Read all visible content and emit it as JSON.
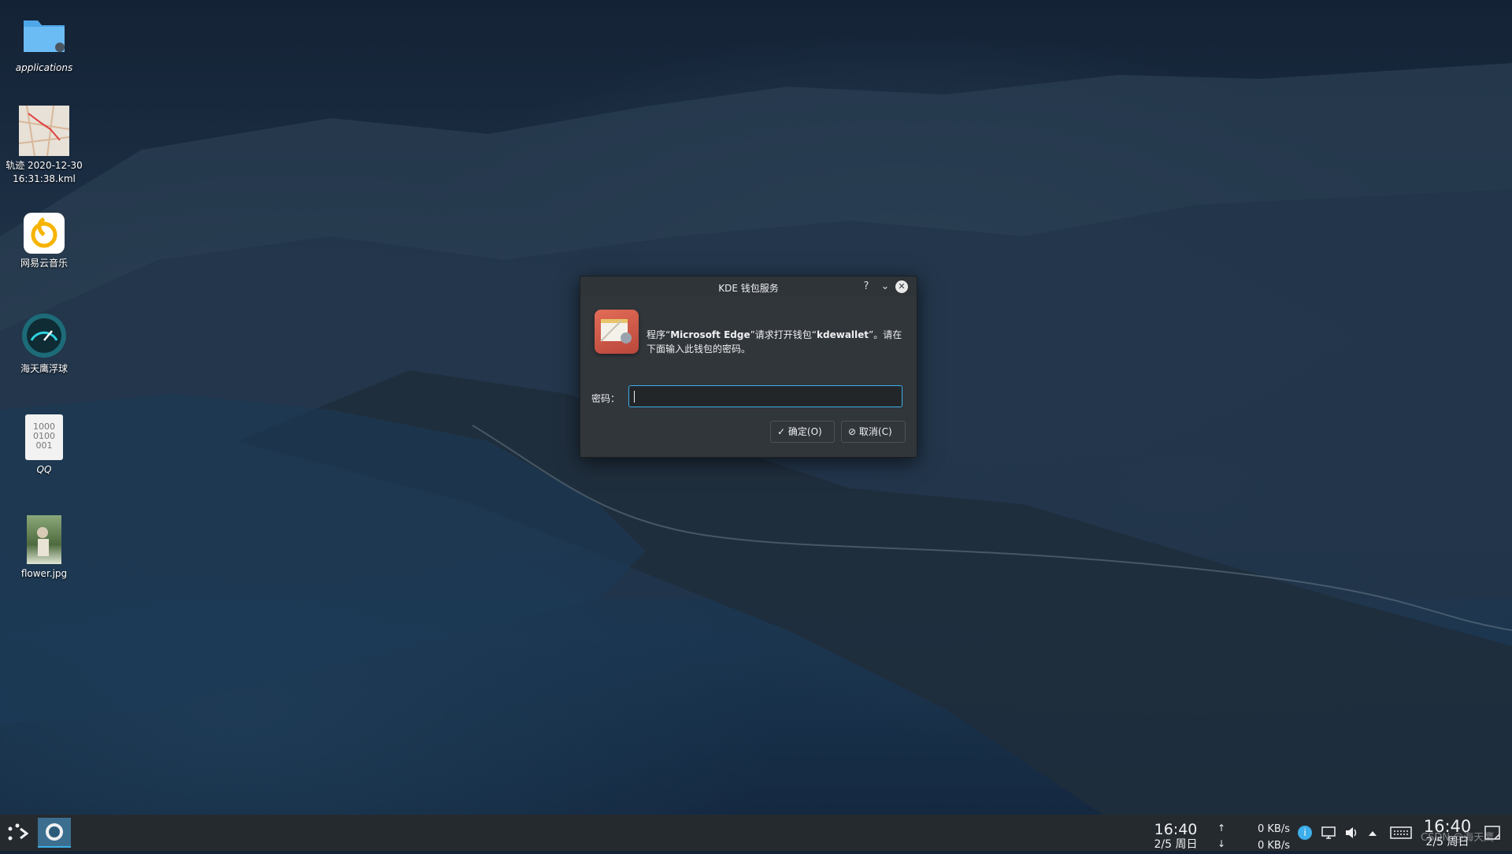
{
  "desktop": {
    "icons": [
      {
        "label": "applications",
        "icon": "folder-icon"
      },
      {
        "label_line1": "轨迹 2020-12-30",
        "label_line2": "16:31:38.kml",
        "icon": "map-file-icon"
      },
      {
        "label": "网易云音乐",
        "icon": "netease-music-icon"
      },
      {
        "label": "海天鹰浮球",
        "icon": "speedometer-icon"
      },
      {
        "label": "QQ",
        "icon": "binary-file-icon",
        "file_text": [
          "1000",
          "0100",
          "001"
        ]
      },
      {
        "label": "flower.jpg",
        "icon": "image-thumbnail-icon"
      }
    ]
  },
  "dialog": {
    "title": "KDE 钱包服务",
    "help_glyph": "?",
    "minimize_glyph": "⌄",
    "close_glyph": "✕",
    "message_prefix": "程序“",
    "app_name": "Microsoft Edge",
    "message_middle": "”请求打开钱包“",
    "wallet_name": "kdewallet",
    "message_suffix": "”。请在下面输入此钱包的密码。",
    "password_label": "密码：",
    "password_value": "",
    "ok_label": "确定(O)",
    "cancel_label": "取消(C)"
  },
  "taskbar": {
    "clock_primary": {
      "time": "16:40",
      "date": "2/5 周日"
    },
    "net_up_arrow": "↑",
    "net_down_arrow": "↓",
    "net_up": "0 KB/s",
    "net_down": "0 KB/s",
    "clock_secondary": {
      "time": "16:40",
      "date": "2/5 周日"
    },
    "watermark": "CSDN @海天鹰"
  },
  "colors": {
    "accent": "#3daee9",
    "dialog_bg": "#31363b",
    "taskbar_bg": "#252a2f"
  }
}
